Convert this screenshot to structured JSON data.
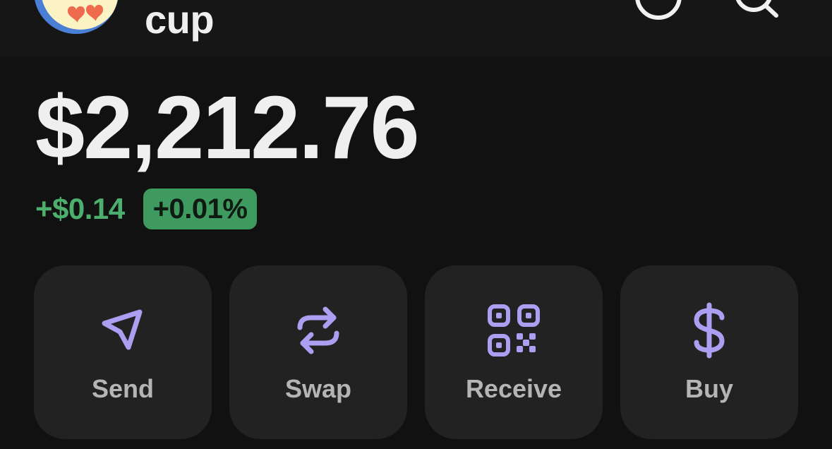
{
  "account": {
    "name": "cup",
    "avatar_icon": "heart-eyes-emoji-icon"
  },
  "header": {
    "icons": [
      "circle-icon",
      "search-icon"
    ]
  },
  "balance": {
    "amount": "$2,212.76",
    "change_amount": "+$0.14",
    "change_percent": "+0.01%"
  },
  "actions": [
    {
      "label": "Send",
      "icon": "paper-plane-icon"
    },
    {
      "label": "Swap",
      "icon": "swap-arrows-icon"
    },
    {
      "label": "Receive",
      "icon": "qr-code-icon"
    },
    {
      "label": "Buy",
      "icon": "dollar-icon"
    }
  ],
  "colors": {
    "background": "#111111",
    "card": "#222222",
    "accent_purple": "#ab9ff2",
    "positive_green": "#4caf6e",
    "badge_green": "#3f9a5f"
  }
}
